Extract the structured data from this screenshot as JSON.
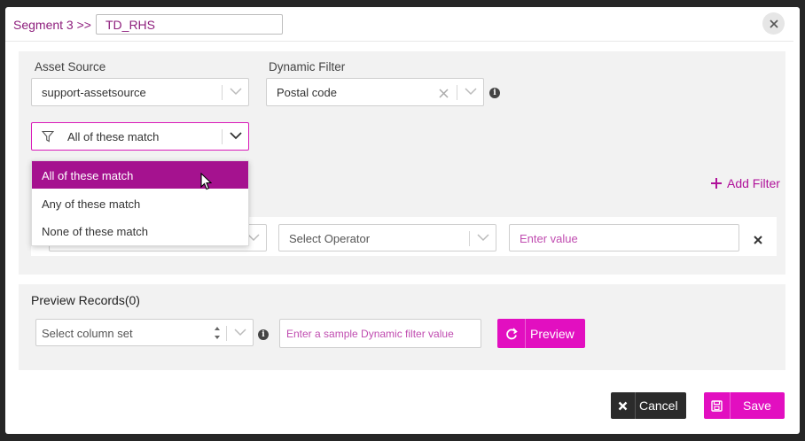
{
  "header": {
    "segment_label": "Segment 3 >>",
    "segment_name": "TD_RHS"
  },
  "filters_panel": {
    "asset_source_label": "Asset Source",
    "asset_source_value": "support-assetsource",
    "dynamic_filter_label": "Dynamic Filter",
    "dynamic_filter_value": "Postal code",
    "match_select_value": "All of these match",
    "match_options": [
      "All of these match",
      "Any of these match",
      "None of these match"
    ],
    "add_filter_label": "Add Filter",
    "operator_placeholder": "Select Operator",
    "value_placeholder": "Enter value"
  },
  "preview_panel": {
    "title": "Preview Records(0)",
    "column_set_placeholder": "Select column set",
    "sample_placeholder": "Enter a sample Dynamic filter value",
    "preview_button": "Preview"
  },
  "footer": {
    "cancel_label": "Cancel",
    "save_label": "Save"
  },
  "colors": {
    "accent": "#e20fc0",
    "accent_dark": "#a5128f",
    "header_text": "#8e1f7d",
    "cancel_bg": "#2b2b2b"
  },
  "icons": [
    "close-icon",
    "chevron-down-icon",
    "clear-icon",
    "info-icon",
    "filter-icon",
    "plus-icon",
    "refresh-icon",
    "save-icon",
    "cursor-icon"
  ]
}
